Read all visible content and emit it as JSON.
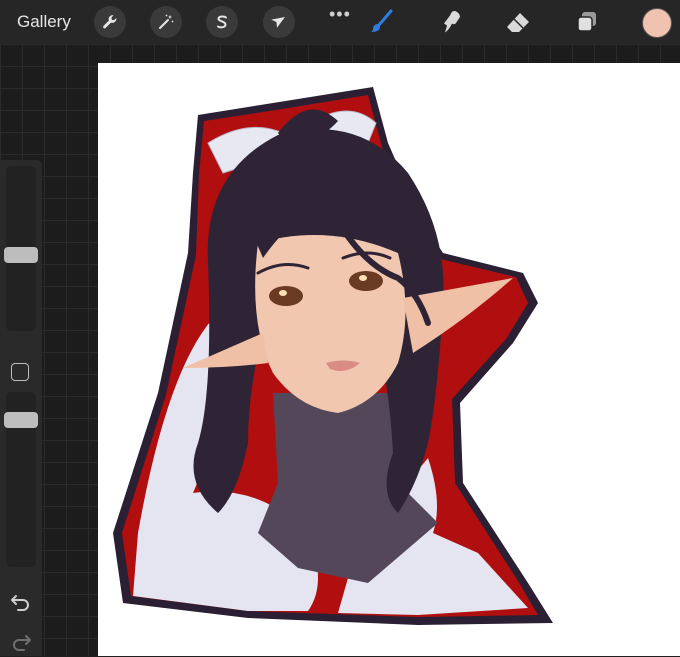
{
  "topbar": {
    "gallery_label": "Gallery",
    "actions_icon": "wrench-icon",
    "adjustments_icon": "magic-wand-icon",
    "selection_icon": "selection-icon",
    "transform_icon": "arrow-cursor-icon",
    "more_label": "•••",
    "brush_icon": "brush-icon",
    "smudge_icon": "smudge-icon",
    "eraser_icon": "eraser-icon",
    "layers_icon": "layers-icon",
    "current_color": "#f0c2b0",
    "active_tool_color": "#2f7de1"
  },
  "sidebar": {
    "brush_size_level": 0.4,
    "opacity_level": 0.2,
    "modify_icon": "square-icon",
    "undo_icon": "undo-icon",
    "redo_icon": "redo-icon"
  },
  "canvas": {
    "artwork": "portrait-illustration",
    "background_color": "#ffffff",
    "accent_red": "#b10f0f",
    "hair_color": "#2e2436",
    "skin_color": "#f2c7b0"
  }
}
